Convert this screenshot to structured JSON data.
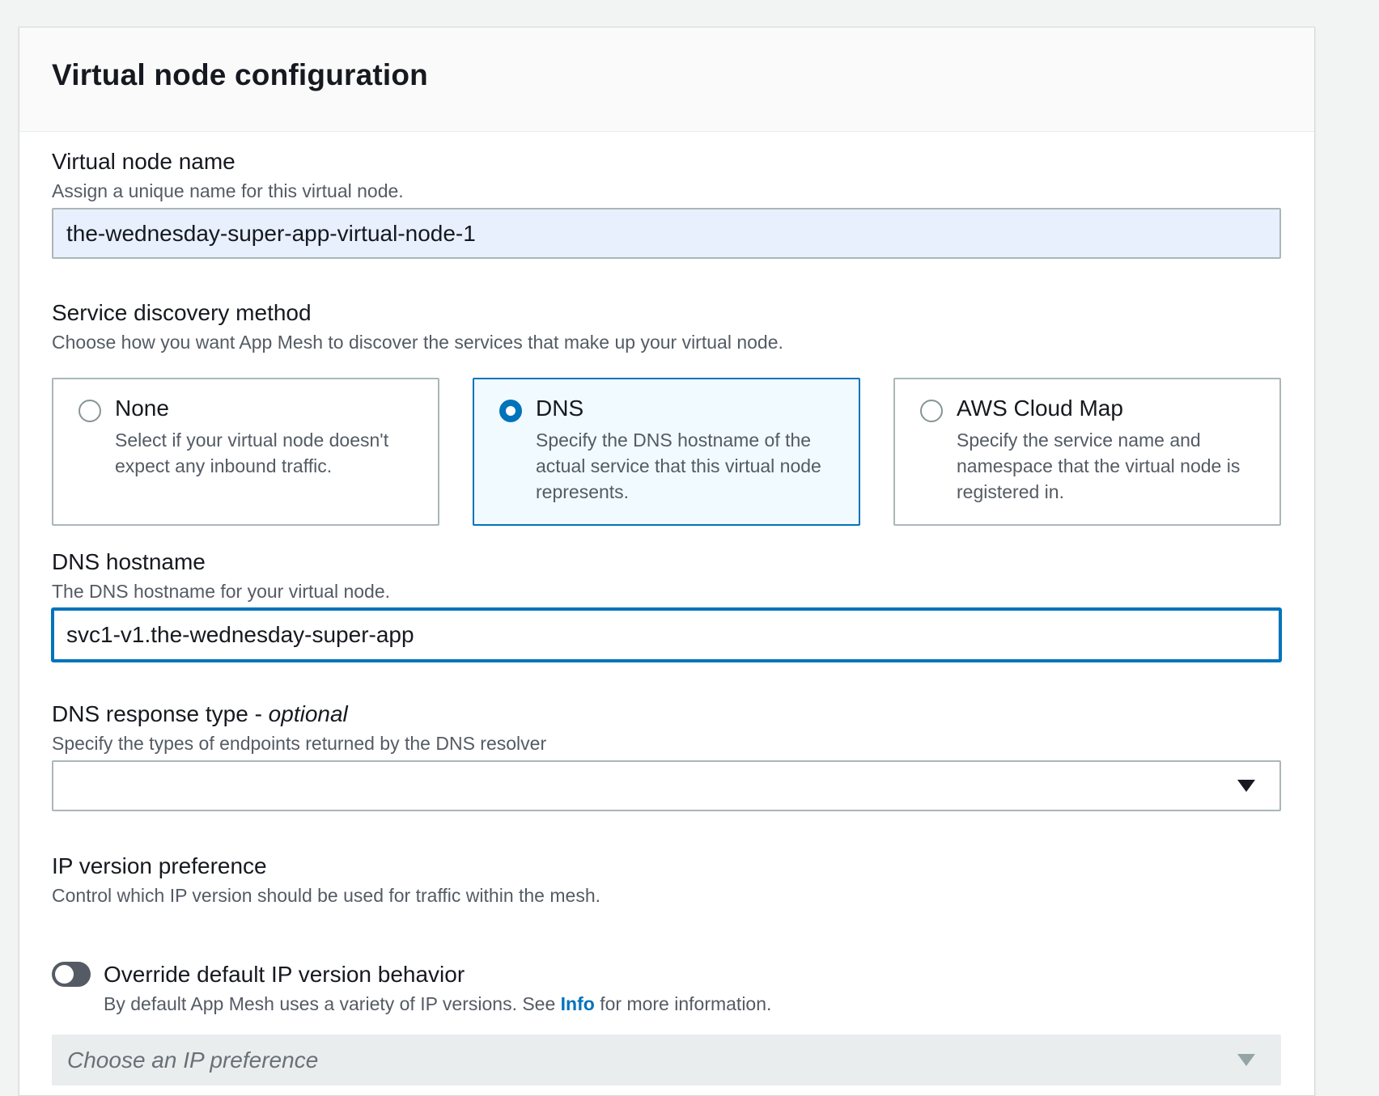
{
  "panel": {
    "title": "Virtual node configuration"
  },
  "virtual_node_name": {
    "label": "Virtual node name",
    "description": "Assign a unique name for this virtual node.",
    "value": "the-wednesday-super-app-virtual-node-1"
  },
  "service_discovery": {
    "label": "Service discovery method",
    "description": "Choose how you want App Mesh to discover the services that make up your virtual node.",
    "selected": "DNS",
    "options": [
      {
        "label": "None",
        "description": "Select if your virtual node doesn't expect any inbound traffic.",
        "checked": false
      },
      {
        "label": "DNS",
        "description": "Specify the DNS hostname of the actual service that this virtual node represents.",
        "checked": true
      },
      {
        "label": "AWS Cloud Map",
        "description": "Specify the service name and namespace that the virtual node is registered in.",
        "checked": false
      }
    ]
  },
  "dns_hostname": {
    "label": "DNS hostname",
    "description": "The DNS hostname for your virtual node.",
    "value": "svc1-v1.the-wednesday-super-app"
  },
  "dns_response_type": {
    "label": "DNS response type - ",
    "label_optional": "optional",
    "description": "Specify the types of endpoints returned by the DNS resolver",
    "value": ""
  },
  "ip_version": {
    "label": "IP version preference",
    "description": "Control which IP version should be used for traffic within the mesh.",
    "toggle_label": "Override default IP version behavior",
    "toggle_on": false,
    "toggle_desc_before": "By default App Mesh uses a variety of IP versions. See ",
    "toggle_desc_link": "Info",
    "toggle_desc_after": " for more information.",
    "select_placeholder": "Choose an IP preference"
  },
  "colors": {
    "accent": "#0073bb",
    "selected_tile_bg": "#f1faff",
    "autofill_bg": "#e8f0fe",
    "toggle_off": "#545b64"
  },
  "icons": {
    "select_caret": "caret-down-icon"
  }
}
